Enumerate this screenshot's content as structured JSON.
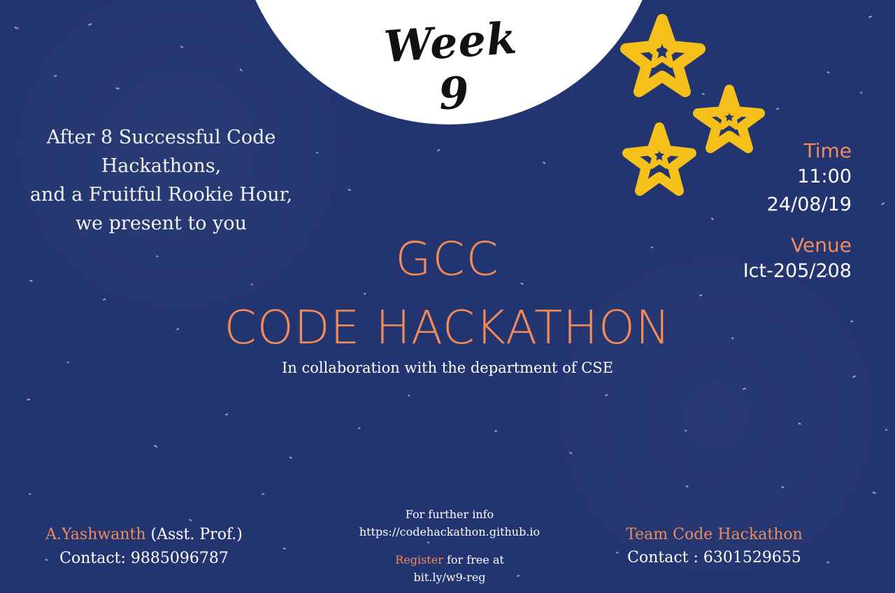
{
  "poster": {
    "week_title": "Week 9",
    "intro_lines": [
      "After 8 Successful Code",
      "Hackathons,",
      "and a Fruitful Rookie Hour,",
      "we present to you"
    ],
    "time": {
      "label": "Time",
      "clock": "11:00",
      "date": "24/08/19"
    },
    "venue": {
      "label": "Venue",
      "value": "Ict-205/208"
    },
    "main_title": {
      "line1": "GCC",
      "line2": "CODE HACKATHON"
    },
    "collaboration": "In collaboration with the department of CSE",
    "left_contact": {
      "name": "A.Yashwanth",
      "role": "(Asst. Prof.)",
      "contact": "Contact: 9885096787"
    },
    "center_contact": {
      "info_label": "For further info",
      "url": "https://codehackathon.github.io",
      "register_word": "Register",
      "register_rest": "for free at",
      "short_link": "bit.ly/w9-reg"
    },
    "right_contact": {
      "team": "Team Code Hackathon",
      "contact": "Contact : 6301529655"
    },
    "icons": {
      "moon": "moon-shape",
      "stars": "star-icon"
    },
    "colors": {
      "background": "#233570",
      "accent": "#ef8b5d",
      "star": "#f6c01a",
      "moon": "#ffffff"
    }
  }
}
